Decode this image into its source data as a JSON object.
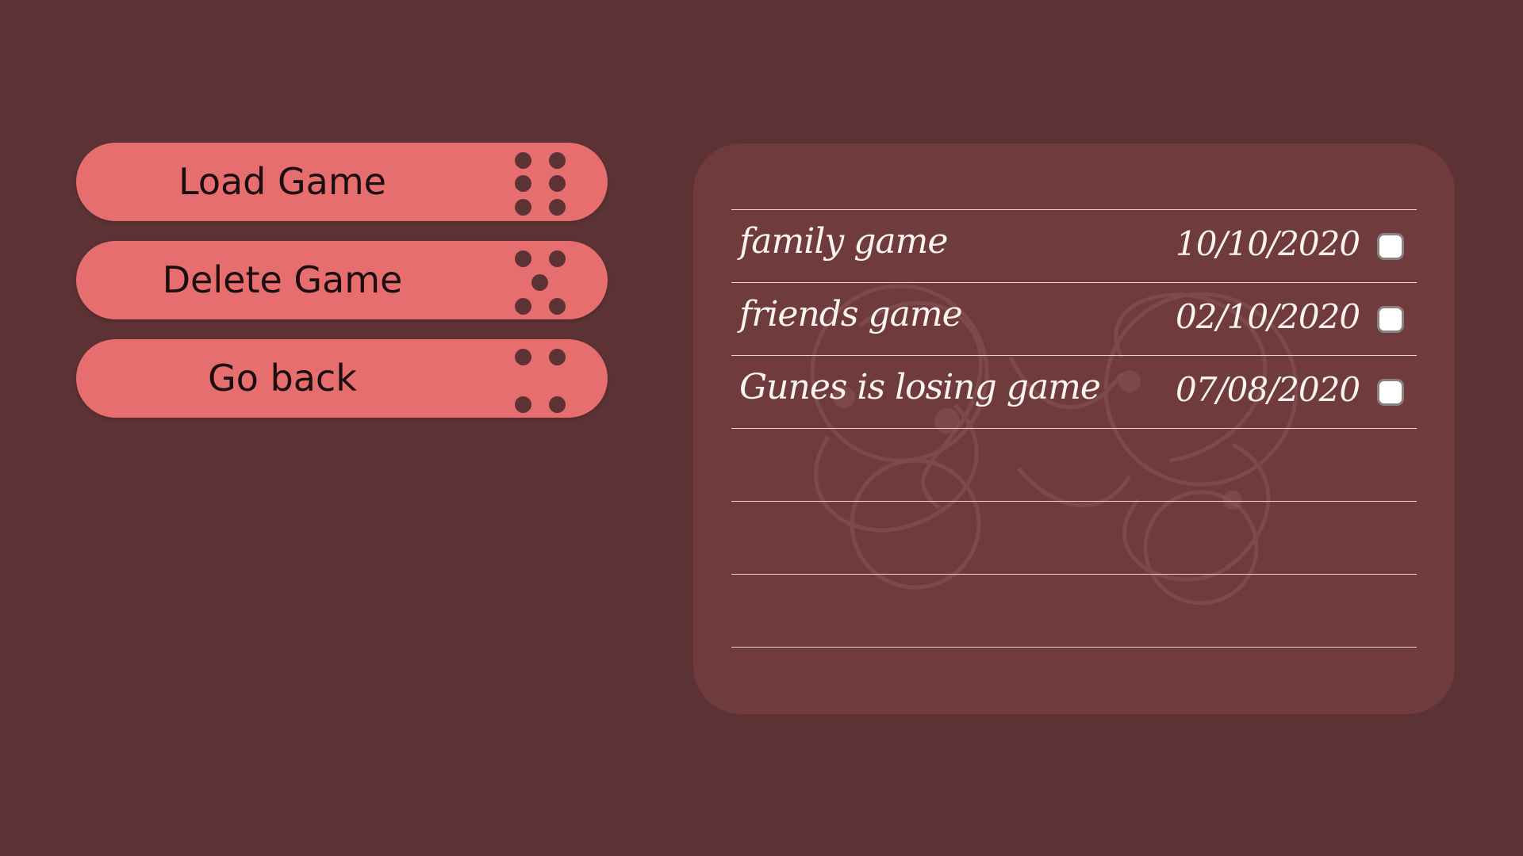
{
  "menu": {
    "buttons": [
      {
        "id": "load",
        "label": "Load Game",
        "dice": 6
      },
      {
        "id": "delete",
        "label": "Delete Game",
        "dice": 5
      },
      {
        "id": "back",
        "label": "Go back",
        "dice": 4
      }
    ]
  },
  "saves": [
    {
      "name": "family game",
      "date": "10/10/2020"
    },
    {
      "name": "friends game",
      "date": "02/10/2020"
    },
    {
      "name": "Gunes is losing game",
      "date": "07/08/2020"
    },
    {
      "name": "",
      "date": ""
    },
    {
      "name": "",
      "date": ""
    },
    {
      "name": "",
      "date": ""
    }
  ],
  "colors": {
    "background": "#5c3234",
    "panel": "#6f3b3c",
    "button": "#e66e6f",
    "text_light": "#fbf4f0",
    "text_dark": "#1c0d0e"
  }
}
